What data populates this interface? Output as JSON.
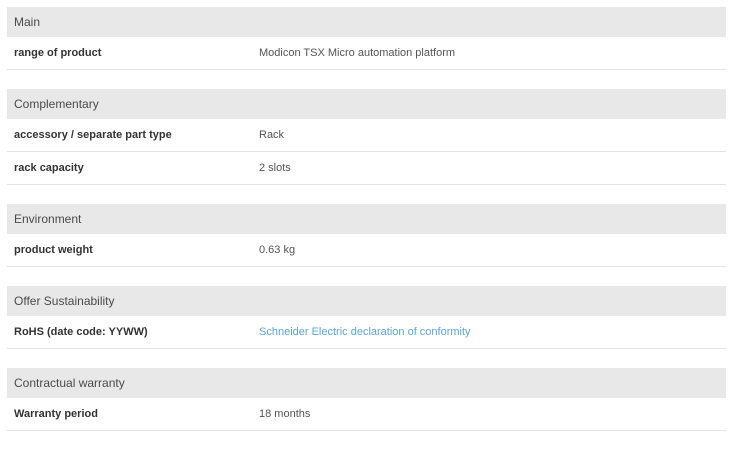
{
  "sections": [
    {
      "title": "Main",
      "rows": [
        {
          "label": "range of product",
          "value": "Modicon TSX Micro automation platform"
        }
      ]
    },
    {
      "title": "Complementary",
      "rows": [
        {
          "label": "accessory / separate part type",
          "value": "Rack"
        },
        {
          "label": "rack capacity",
          "value": "2 slots"
        }
      ]
    },
    {
      "title": "Environment",
      "rows": [
        {
          "label": "product weight",
          "value": "0.63 kg"
        }
      ]
    },
    {
      "title": "Offer Sustainability",
      "rows": [
        {
          "label": "RoHS (date code: YYWW)",
          "value": "Schneider Electric declaration of conformity"
        }
      ]
    },
    {
      "title": "Contractual warranty",
      "rows": [
        {
          "label": "Warranty period",
          "value": "18 months"
        }
      ]
    }
  ],
  "colors": {
    "header_bg": "#e8e8e8",
    "link": "#5aa5d8",
    "divider": "#e3e3e3"
  }
}
